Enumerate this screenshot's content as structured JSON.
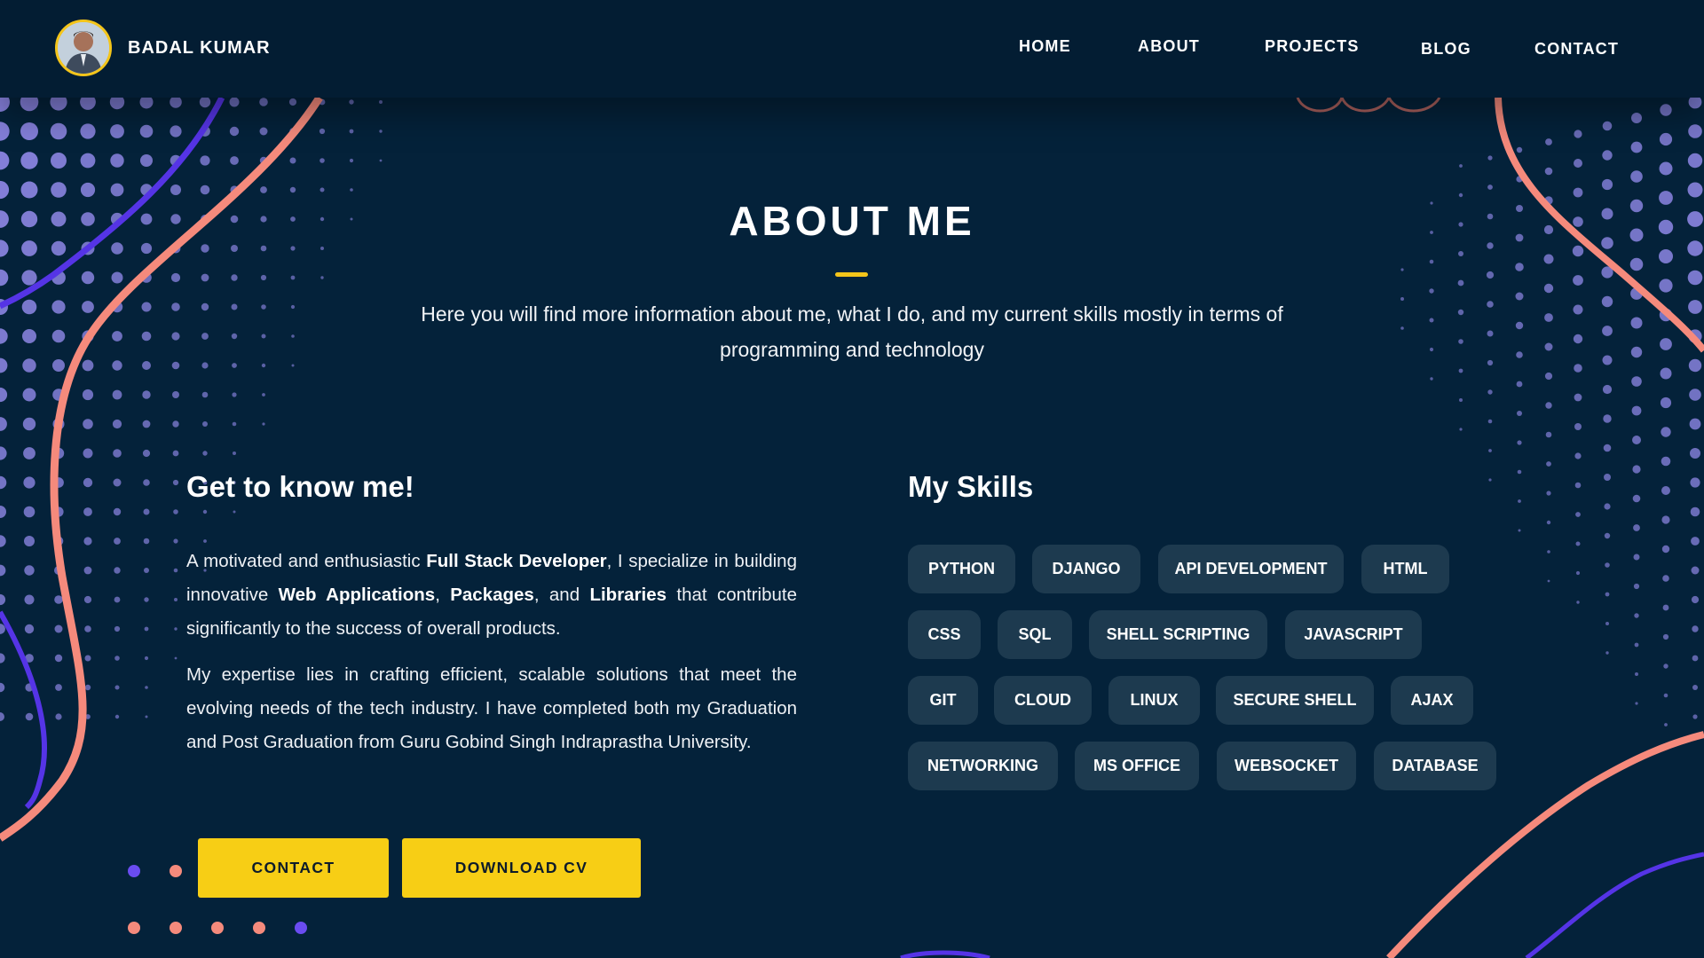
{
  "navbar": {
    "brand_name": "BADAL KUMAR",
    "links": [
      "HOME",
      "ABOUT",
      "PROJECTS",
      "BLOG",
      "CONTACT"
    ]
  },
  "about": {
    "title": "ABOUT ME",
    "subtitle": "Here you will find more information about me, what I do, and my current skills mostly in terms of programming and technology"
  },
  "intro": {
    "heading": "Get to know me!",
    "para1": {
      "t1": "A motivated and enthusiastic ",
      "b1": "Full Stack Developer",
      "t2": ", I specialize in building innovative ",
      "b2": "Web Applications",
      "t3": ", ",
      "b3": "Packages",
      "t4": ", and ",
      "b4": "Libraries",
      "t5": " that contribute significantly to the success of overall products."
    },
    "para2": "My expertise lies in crafting efficient, scalable solutions that meet the evolving needs of the tech industry. I have completed both my Graduation and Post Graduation from Guru Gobind Singh Indraprastha University.",
    "buttons": {
      "contact": "CONTACT",
      "download_cv": "DOWNLOAD CV"
    }
  },
  "skills": {
    "heading": "My Skills",
    "items": [
      "PYTHON",
      "DJANGO",
      "API DEVELOPMENT",
      "HTML",
      "CSS",
      "SQL",
      "SHELL SCRIPTING",
      "JAVASCRIPT",
      "GIT",
      "CLOUD",
      "LINUX",
      "SECURE SHELL",
      "AJAX",
      "NETWORKING",
      "MS OFFICE",
      "WEBSOCKET",
      "DATABASE"
    ]
  },
  "colors": {
    "background": "#04223a",
    "navbar": "#031d33",
    "accent_yellow": "#f7ce15",
    "chip_bg": "#1d3a4f",
    "dots_purple": "#8a84e0",
    "curve_coral": "#f58a7c",
    "curve_violet": "#5534e6"
  },
  "icons": {
    "avatar": "profile-photo"
  }
}
